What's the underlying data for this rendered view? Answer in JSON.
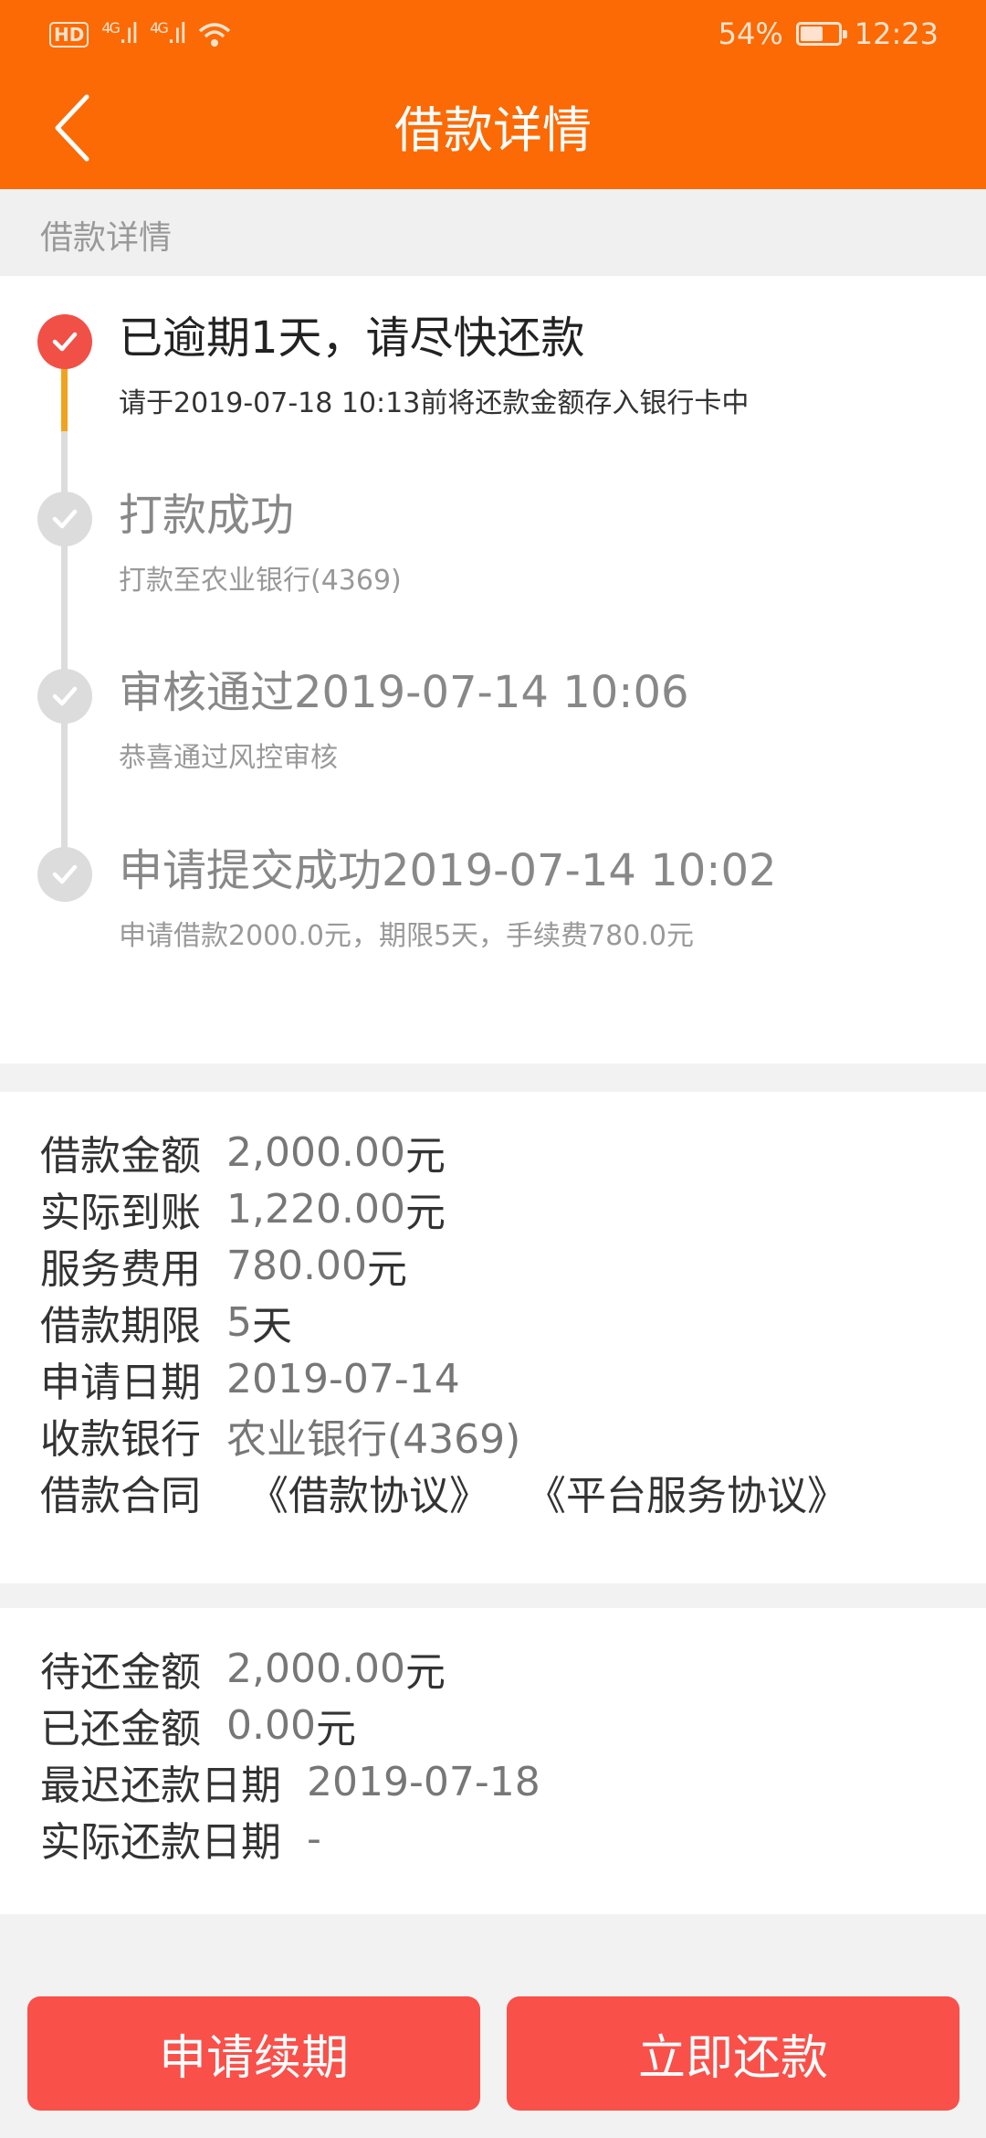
{
  "status_bar": {
    "hd": "HD",
    "net1": "4G",
    "net2": "4G",
    "battery": "54%",
    "time": "12:23"
  },
  "header": {
    "title": "借款详情"
  },
  "section_label": "借款详情",
  "timeline": [
    {
      "title": "已逾期1天，请尽快还款",
      "desc": "请于2019-07-18 10:13前将还款金额存入银行卡中",
      "active": true
    },
    {
      "title": "打款成功",
      "desc": "打款至农业银行(4369)",
      "active": false
    },
    {
      "title": "审核通过2019-07-14 10:06",
      "desc": "恭喜通过风控审核",
      "active": false
    },
    {
      "title": "申请提交成功2019-07-14 10:02",
      "desc": "申请借款2000.0元，期限5天，手续费780.0元",
      "active": false
    }
  ],
  "loan_details": {
    "amount": {
      "label": "借款金额",
      "value": "2,000.00",
      "unit": "元"
    },
    "received": {
      "label": "实际到账",
      "value": "1,220.00",
      "unit": "元"
    },
    "service_fee": {
      "label": "服务费用",
      "value": "780.00",
      "unit": "元"
    },
    "term": {
      "label": "借款期限",
      "value": "5",
      "unit": "天"
    },
    "apply_date": {
      "label": "申请日期",
      "value": "2019-07-14"
    },
    "bank": {
      "label": "收款银行",
      "value": "农业银行(4369)"
    },
    "contract": {
      "label": "借款合同",
      "link1": "《借款协议》",
      "link2": "《平台服务协议》"
    }
  },
  "repay_details": {
    "due_amount": {
      "label": "待还金额",
      "value": "2,000.00",
      "unit": "元"
    },
    "repaid": {
      "label": "已还金额",
      "value": "0.00",
      "unit": "元"
    },
    "latest_date": {
      "label": "最迟还款日期",
      "value": "2019-07-18"
    },
    "actual_date": {
      "label": "实际还款日期",
      "value": "-"
    }
  },
  "buttons": {
    "renew": "申请续期",
    "repay": "立即还款"
  },
  "colors": {
    "header": "#fb6a04",
    "active": "#f15047",
    "active_line": "#f0a41e",
    "inactive": "#dcdcdc",
    "button": "#f9504a"
  }
}
